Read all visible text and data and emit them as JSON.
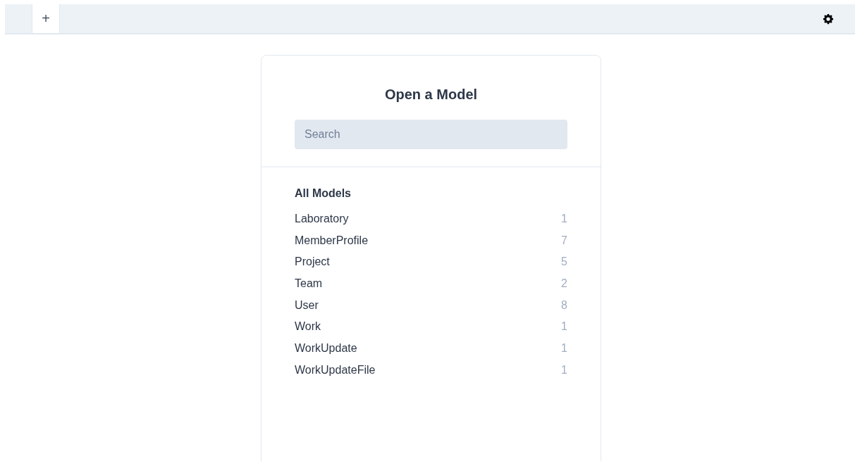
{
  "toolbar": {
    "add_tab": "+"
  },
  "dialog": {
    "title": "Open a Model",
    "search": {
      "placeholder": "Search"
    },
    "section_title": "All Models",
    "models": [
      {
        "name": "Laboratory",
        "count": "1"
      },
      {
        "name": "MemberProfile",
        "count": "7"
      },
      {
        "name": "Project",
        "count": "5"
      },
      {
        "name": "Team",
        "count": "2"
      },
      {
        "name": "User",
        "count": "8"
      },
      {
        "name": "Work",
        "count": "1"
      },
      {
        "name": "WorkUpdate",
        "count": "1"
      },
      {
        "name": "WorkUpdateFile",
        "count": "1"
      }
    ]
  }
}
